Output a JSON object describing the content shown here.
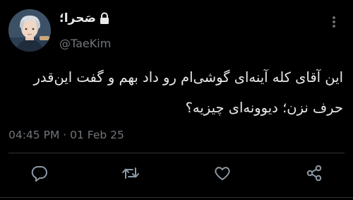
{
  "tweet": {
    "author": {
      "display_name": "صَحرا؛",
      "handle": "@TaeKim",
      "locked": true,
      "avatar": "avatar-photo"
    },
    "text_lines": [
      "این آقای کله آینه‌ای گوشی‌ام رو داد بهم و گفت این‌قدر",
      "حرف نزن؛ دیوونه‌ای چیزیه؟"
    ],
    "time": "04:45 PM",
    "separator": "·",
    "date": "01 Feb 25",
    "actions": [
      {
        "name": "reply",
        "icon": "reply-icon"
      },
      {
        "name": "retweet",
        "icon": "retweet-icon"
      },
      {
        "name": "like",
        "icon": "heart-icon"
      },
      {
        "name": "share",
        "icon": "share-icon"
      }
    ]
  },
  "colors": {
    "background": "#000000",
    "text": "#e7e9ea",
    "secondary": "#71767b",
    "divider": "#2f3336"
  }
}
